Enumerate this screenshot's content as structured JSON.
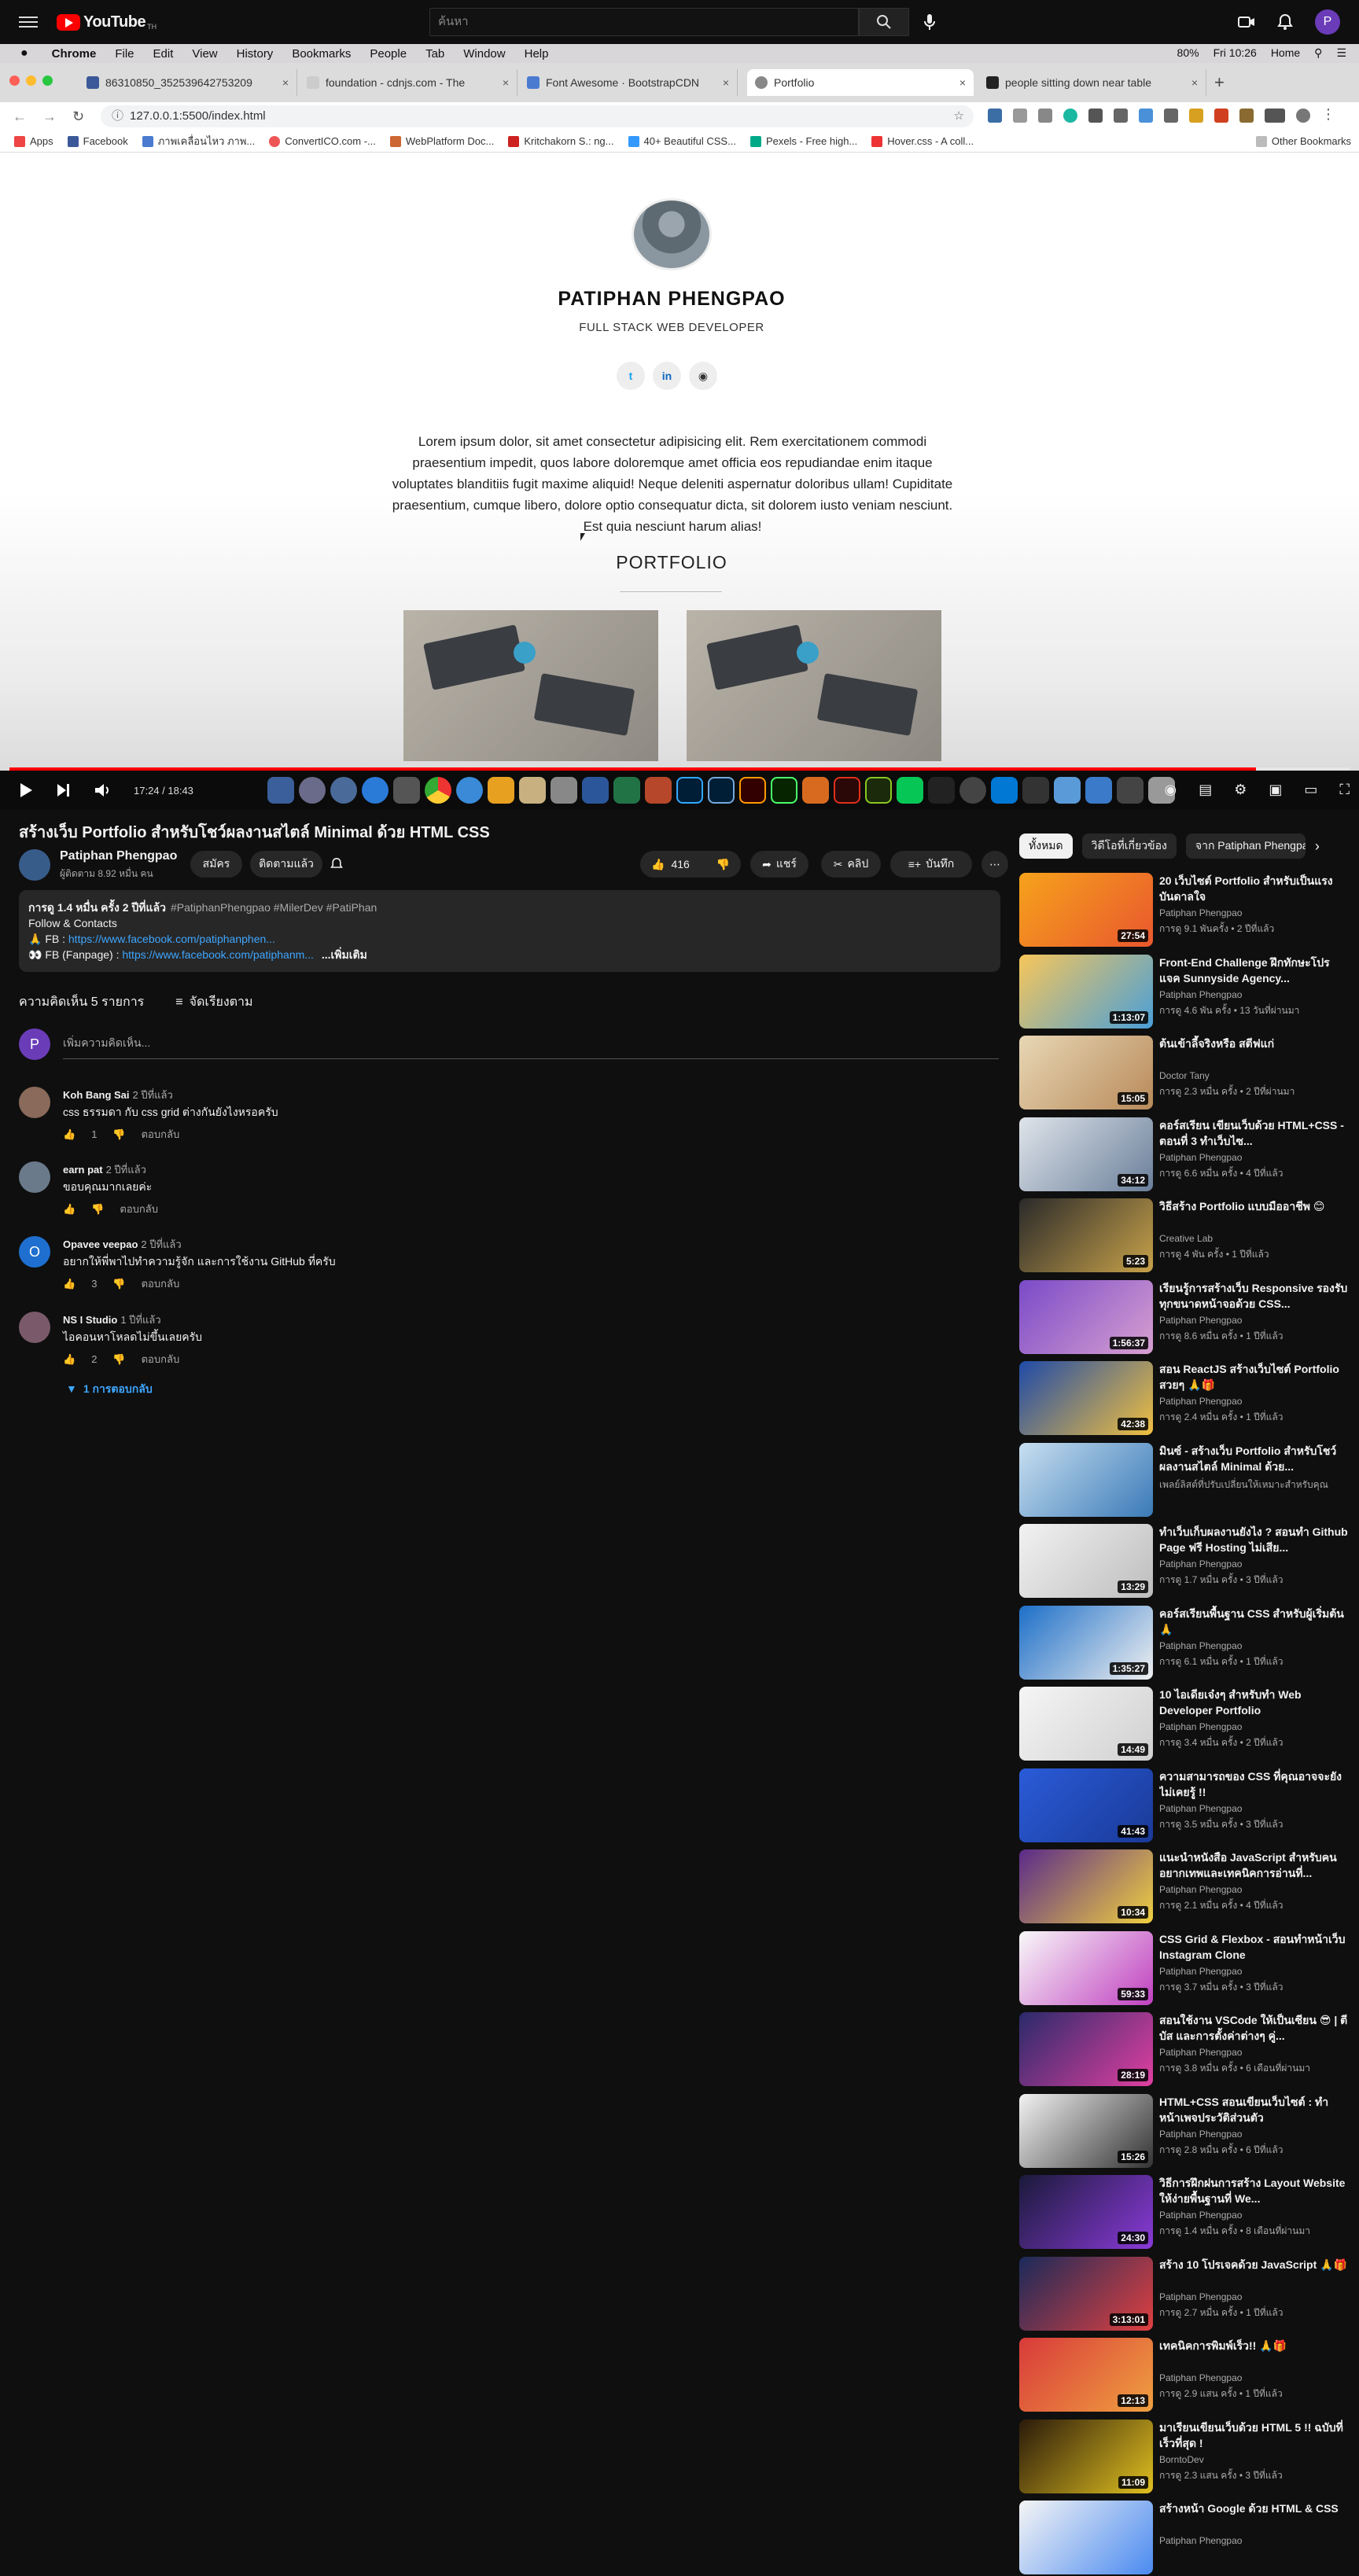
{
  "yt": {
    "logo": "YouTube",
    "search_placeholder": "ค้นหา"
  },
  "mac": {
    "menu": [
      "Chrome",
      "File",
      "Edit",
      "View",
      "History",
      "Bookmarks",
      "People",
      "Tab",
      "Window",
      "Help"
    ],
    "battery": "80%",
    "input_source": "Home",
    "clock": "Fri 10:26"
  },
  "tabs": [
    {
      "title": "86310850_352539642753209",
      "color": "#3b5998"
    },
    {
      "title": "foundation - cdnjs.com - The",
      "color": "#888"
    },
    {
      "title": "Font Awesome · BootstrapCDN",
      "color": "#4a7bd0"
    },
    {
      "title": "Portfolio",
      "color": "#666"
    },
    {
      "title": "people sitting down near table",
      "color": "#222"
    }
  ],
  "address": "127.0.0.1:5500/index.html",
  "bookmarks": [
    {
      "label": "Apps",
      "color": "#e44"
    },
    {
      "label": "Facebook",
      "color": "#3b5998"
    },
    {
      "label": "ภาพเคลื่อนไหว ภาพ...",
      "color": "#4a7bd0"
    },
    {
      "label": "ConvertICO.com -...",
      "color": "#e55"
    },
    {
      "label": "WebPlatform Doc...",
      "color": "#c63"
    },
    {
      "label": "Kritchakorn S.: ng...",
      "color": "#c22"
    },
    {
      "label": "40+ Beautiful CSS...",
      "color": "#39f"
    },
    {
      "label": "Pexels - Free high...",
      "color": "#0a8"
    },
    {
      "label": "Hover.css - A coll...",
      "color": "#e33"
    }
  ],
  "other_bookmarks": "Other Bookmarks",
  "portfolio": {
    "name": "PATIPHAN PHENGPAO",
    "role": "FULL STACK WEB DEVELOPER",
    "bio": "Lorem ipsum dolor, sit amet consectetur adipisicing elit. Rem exercitationem commodi praesentium impedit, quos labore doloremque amet officia eos repudiandae enim itaque voluptates blanditiis fugit maxime aliquid! Neque deleniti aspernatur doloribus ullam! Cupiditate praesentium, cumque libero, dolore optio consequatur dicta, sit dolorem iusto veniam nesciunt. Est quia nesciunt harum alias!",
    "section": "PORTFOLIO"
  },
  "player": {
    "time": "17:24 / 18:43",
    "progress": 0.93
  },
  "video": {
    "title": "สร้างเว็บ Portfolio สำหรับโชว์ผลงานสไตล์ Minimal ด้วย HTML CSS",
    "channel": "Patiphan Phengpao",
    "subs": "ผู้ติดตาม 8.92 หมื่น คน",
    "join": "สมัคร",
    "subscribed": "ติดตามแล้ว",
    "likes": "416",
    "share": "แชร์",
    "clip": "คลิป",
    "save": "บันทึก",
    "desc_meta": "การดู 1.4 หมื่น ครั้ง  2 ปีที่แล้ว",
    "desc_tags": "#PatiphanPhengpao #MilerDev #PatiPhan",
    "desc_line1": "Follow & Contacts",
    "desc_fb_label": "🙏 FB : ",
    "desc_fb_link": "https://www.facebook.com/patiphanphen...",
    "desc_fbp_label": "👀 FB (Fanpage) : ",
    "desc_fbp_link": "https://www.facebook.com/patiphanm...",
    "more": "...เพิ่มเติม"
  },
  "comments": {
    "count": "ความคิดเห็น 5 รายการ",
    "sort": "จัดเรียงตาม",
    "avatar_letter": "P",
    "placeholder": "เพิ่มความคิดเห็น...",
    "reply": "ตอบกลับ",
    "items": [
      {
        "name": "Koh Bang Sai",
        "time": "2 ปีที่แล้ว",
        "text": "css ธรรมดา กับ css grid  ต่างกันยังไงหรอครับ",
        "likes": "1",
        "color": "#8a6a5a",
        "letter": ""
      },
      {
        "name": "earn pat",
        "time": "2 ปีที่แล้ว",
        "text": "ขอบคุณมากเลยค่ะ",
        "likes": "",
        "color": "#6a7a8a",
        "letter": ""
      },
      {
        "name": "Opavee veepao",
        "time": "2 ปีที่แล้ว",
        "text": "อยากให้พี่พาไปทำความรู้จัก และการใช้งาน GitHub ที่ครับ",
        "likes": "3",
        "color": "#1e6fd0",
        "letter": "O"
      },
      {
        "name": "NS I Studio",
        "time": "1 ปีที่แล้ว",
        "text": "ไอคอนหาโหลดไม่ขึ้นเลยครับ",
        "likes": "2",
        "color": "#7a5a6a",
        "letter": ""
      }
    ],
    "replies": "1 การตอบกลับ"
  },
  "chips": [
    "ทั้งหมด",
    "วิดีโอที่เกี่ยวข้อง",
    "จาก Patiphan Phengpao"
  ],
  "recs": [
    {
      "title": "20 เว็บไซต์ Portfolio สำหรับเป็นแรงบันดาลใจ",
      "channel": "Patiphan Phengpao",
      "views": "การดู 9.1 พันครั้ง • 2 ปีที่แล้ว",
      "dur": "27:54",
      "c1": "#f6a21b",
      "c2": "#e9572e"
    },
    {
      "title": "Front-End Challenge ฝึกทักษะโปรแจค Sunnyside Agency...",
      "channel": "Patiphan Phengpao",
      "views": "การดู 4.6 พัน ครั้ง • 13 วันที่ผ่านมา",
      "dur": "1:13:07",
      "c1": "#f7c65a",
      "c2": "#4a9fd8"
    },
    {
      "title": "ต้นเข้าลี้จริงหรือ สตีฟแก่",
      "channel": "Doctor Tany",
      "views": "การดู 2.3 หมื่น ครั้ง • 2 ปีที่ผ่านมา",
      "dur": "15:05",
      "c1": "#e8d7b5",
      "c2": "#b88a5a"
    },
    {
      "title": "คอร์สเรียน เขียนเว็บด้วย HTML+CSS - ตอนที่ 3 ทำเว็บไซ...",
      "channel": "Patiphan Phengpao",
      "views": "การดู 6.6 หมื่น ครั้ง • 4 ปีที่แล้ว",
      "dur": "34:12",
      "c1": "#dfe4ea",
      "c2": "#6a7f9a"
    },
    {
      "title": "วิธีสร้าง Portfolio แบบมืออาชีพ 😊",
      "channel": "Creative Lab",
      "views": "การดู 4 พัน ครั้ง • 1 ปีที่แล้ว",
      "dur": "5:23",
      "c1": "#2a2a2a",
      "c2": "#c8a24a"
    },
    {
      "title": "เรียนรู้การสร้างเว็บ Responsive รองรับทุกขนาดหน้าจอด้วย CSS...",
      "channel": "Patiphan Phengpao",
      "views": "การดู 8.6 หมื่น ครั้ง • 1 ปีที่แล้ว",
      "dur": "1:56:37",
      "c1": "#7a4ac8",
      "c2": "#d8a0d0"
    },
    {
      "title": "สอน ReactJS สร้างเว็บไซต์ Portfolio สวยๆ 🙏🎁",
      "channel": "Patiphan Phengpao",
      "views": "การดู 2.4 หมื่น ครั้ง • 1 ปีที่แล้ว",
      "dur": "42:38",
      "c1": "#1f4aa8",
      "c2": "#f0c040"
    },
    {
      "title": "มินซ์ - สร้างเว็บ Portfolio สำหรับโชว์ผลงานสไตล์ Minimal ด้วย...",
      "channel": "เพลย์ลิสต์ที่ปรับเปลี่ยนให้เหมาะสำหรับคุณ",
      "views": "",
      "dur": "",
      "c1": "#c8dff0",
      "c2": "#3a7ab8"
    },
    {
      "title": "ทำเว็บเก็บผลงานยังไง ? สอนทำ Github Page ฟรี Hosting ไม่เสีย...",
      "channel": "Patiphan Phengpao",
      "views": "การดู 1.7 หมื่น ครั้ง • 3 ปีที่แล้ว",
      "dur": "13:29",
      "c1": "#f2f2f2",
      "c2": "#bdbdbd"
    },
    {
      "title": "คอร์สเรียนพื้นฐาน CSS สำหรับผู้เริ่มต้น 🙏",
      "channel": "Patiphan Phengpao",
      "views": "การดู 6.1 หมื่น ครั้ง • 1 ปีที่แล้ว",
      "dur": "1:35:27",
      "c1": "#1d6fc8",
      "c2": "#f0f0f0"
    },
    {
      "title": "10 ไอเดียเจ๋งๆ สำหรับทำ Web Developer Portfolio",
      "channel": "Patiphan Phengpao",
      "views": "การดู 3.4 หมื่น ครั้ง • 2 ปีที่แล้ว",
      "dur": "14:49",
      "c1": "#f5f5f5",
      "c2": "#d0d0d0"
    },
    {
      "title": "ความสามารถของ CSS ที่คุณอาจจะยังไม่เคยรู้ !!",
      "channel": "Patiphan Phengpao",
      "views": "การดู 3.5 หมื่น ครั้ง • 3 ปีที่แล้ว",
      "dur": "41:43",
      "c1": "#2a5bd8",
      "c2": "#1a3a98"
    },
    {
      "title": "แนะนำหนังสือ JavaScript สำหรับคนอยากเทพและเทคนิคการอ่านที่...",
      "channel": "Patiphan Phengpao",
      "views": "การดู 2.1 หมื่น ครั้ง • 4 ปีที่แล้ว",
      "dur": "10:34",
      "c1": "#5a2a8a",
      "c2": "#f0d040"
    },
    {
      "title": "CSS Grid & Flexbox - สอนทำหน้าเว็บ Instagram Clone",
      "channel": "Patiphan Phengpao",
      "views": "การดู 3.7 หมื่น ครั้ง • 3 ปีที่แล้ว",
      "dur": "59:33",
      "c1": "#f8f8f8",
      "c2": "#c040c0"
    },
    {
      "title": "สอนใช้งาน VSCode ให้เป็นเซียน 😎 | ตีบัส และการตั้งค่าต่างๆ คู่...",
      "channel": "Patiphan Phengpao",
      "views": "การดู 3.8 หมื่น ครั้ง • 6 เดือนที่ผ่านมา",
      "dur": "28:19",
      "c1": "#2a2a6a",
      "c2": "#e040a0"
    },
    {
      "title": "HTML+CSS สอนเขียนเว็บไซต์ : ทำหน้าเพจประวัติส่วนตัว",
      "channel": "Patiphan Phengpao",
      "views": "การดู 2.8 หมื่น ครั้ง • 6 ปีที่แล้ว",
      "dur": "15:26",
      "c1": "#f2f2f2",
      "c2": "#333"
    },
    {
      "title": "วิธีการฝึกฝนการสร้าง Layout Website ให้ง่ายพื้นฐานที่ We...",
      "channel": "Patiphan Phengpao",
      "views": "การดู 1.4 หมื่น ครั้ง • 8 เดือนที่ผ่านมา",
      "dur": "24:30",
      "c1": "#1a1a3a",
      "c2": "#8a3ad8"
    },
    {
      "title": "สร้าง 10 โปรเจคด้วย JavaScript 🙏🎁",
      "channel": "Patiphan Phengpao",
      "views": "การดู 2.7 หมื่น ครั้ง • 1 ปีที่แล้ว",
      "dur": "3:13:01",
      "c1": "#1a2a5a",
      "c2": "#e04040"
    },
    {
      "title": "เทคนิคการพิมพ์เร็ว!! 🙏🎁",
      "channel": "Patiphan Phengpao",
      "views": "การดู 2.9 แสน ครั้ง • 1 ปีที่แล้ว",
      "dur": "12:13",
      "c1": "#d83a3a",
      "c2": "#f0a040"
    },
    {
      "title": "มาเรียนเขียนเว็บด้วย HTML 5 !! ฉบับที่เร็วที่สุด !",
      "channel": "BorntoDev",
      "views": "การดู 2.3 แสน ครั้ง • 3 ปีที่แล้ว",
      "dur": "11:09",
      "c1": "#2a1a0a",
      "c2": "#e0c020"
    },
    {
      "title": "สร้างหน้า Google ด้วย HTML & CSS",
      "channel": "Patiphan Phengpao",
      "views": "",
      "dur": "",
      "c1": "#f5f5f5",
      "c2": "#4a8af0"
    }
  ]
}
